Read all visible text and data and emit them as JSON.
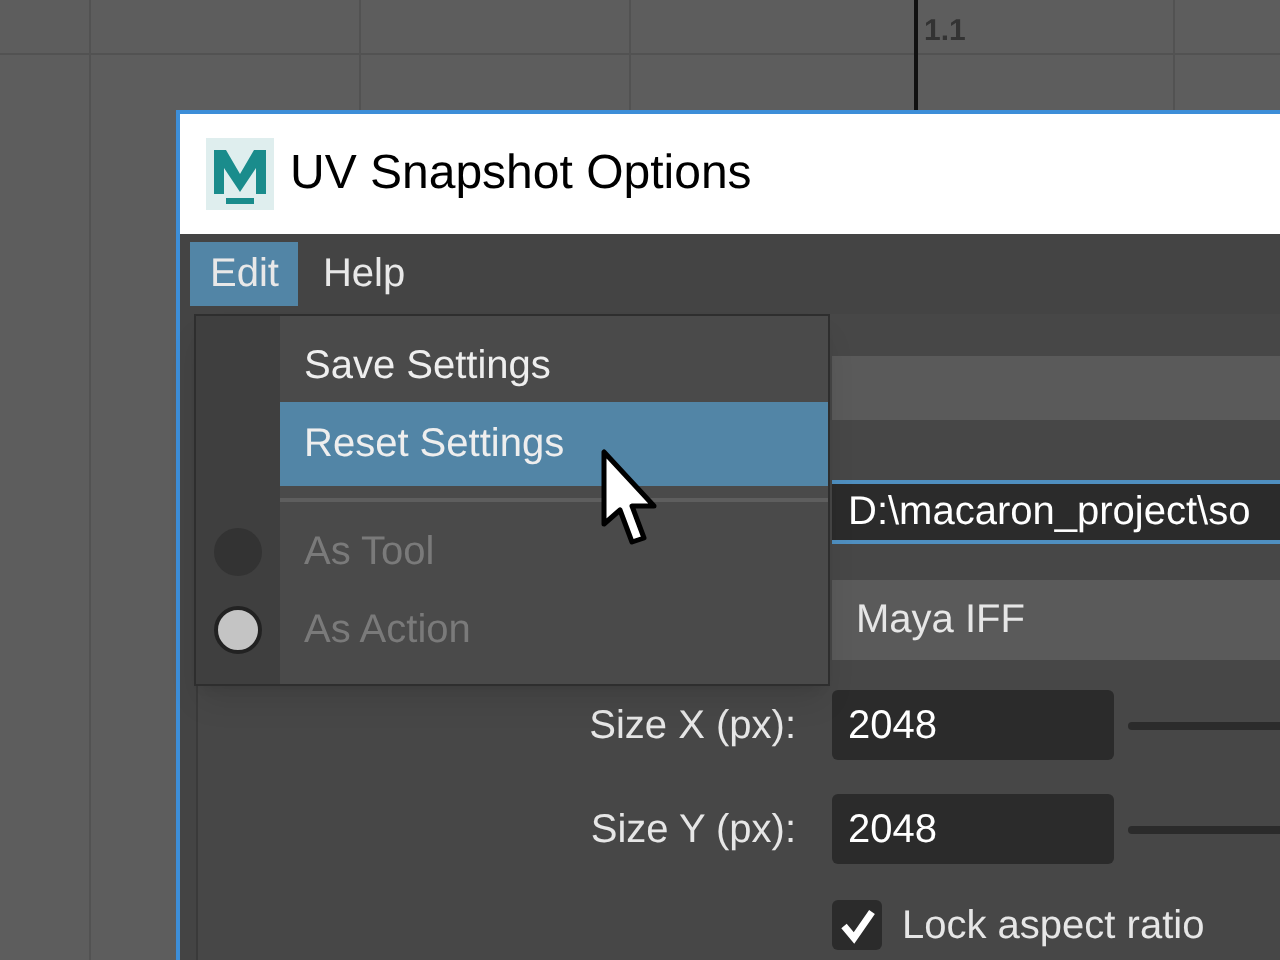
{
  "viewport": {
    "label": "1.1"
  },
  "window": {
    "title": "UV Snapshot Options"
  },
  "menu_bar": [
    {
      "label": "Edit",
      "selected": true
    },
    {
      "label": "Help",
      "selected": false
    }
  ],
  "menu": {
    "items": [
      {
        "kind": "command",
        "label": "Save Settings",
        "highlighted": false
      },
      {
        "kind": "command",
        "label": "Reset Settings",
        "highlighted": true
      },
      {
        "kind": "separator"
      },
      {
        "kind": "radio",
        "label": "As Tool",
        "selected": false,
        "disabled": true
      },
      {
        "kind": "radio",
        "label": "As Action",
        "selected": true,
        "disabled": true
      }
    ]
  },
  "form": {
    "file_name": {
      "value": "D:\\macaron_project\\so"
    },
    "image_format": {
      "value": "Maya IFF"
    },
    "size_x": {
      "label": "Size X (px):",
      "value": "2048"
    },
    "size_y": {
      "label": "Size Y (px):",
      "value": "2048"
    },
    "lock_aspect_ratio": {
      "label": "Lock aspect ratio",
      "checked": true
    }
  }
}
